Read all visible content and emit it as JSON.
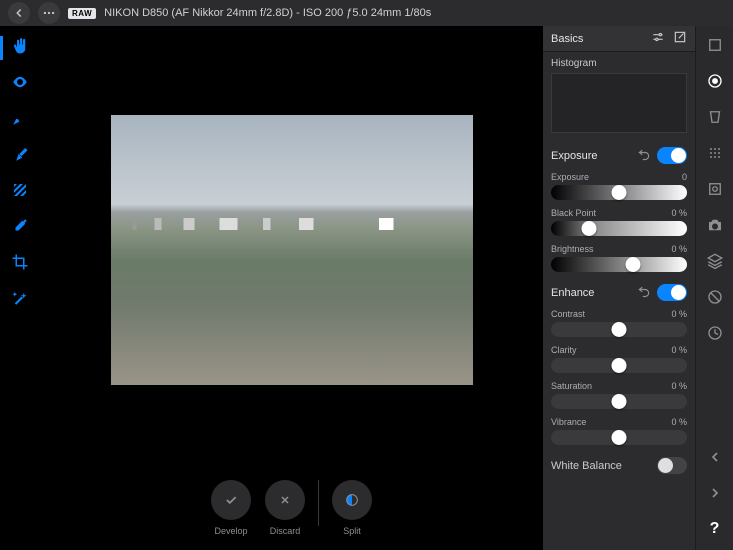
{
  "header": {
    "raw_badge": "RAW",
    "title": "NIKON D850 (AF Nikkor 24mm f/2.8D) - ISO 200 ƒ5.0 24mm 1/80s"
  },
  "bottom": {
    "develop": "Develop",
    "discard": "Discard",
    "split": "Split"
  },
  "panel": {
    "title": "Basics",
    "histogram_label": "Histogram",
    "sections": {
      "exposure": {
        "title": "Exposure",
        "toggle_on": true
      },
      "enhance": {
        "title": "Enhance",
        "toggle_on": true
      },
      "white_balance": {
        "title": "White Balance",
        "toggle_on": false
      }
    },
    "sliders": {
      "exposure": {
        "label": "Exposure",
        "value": "0",
        "pos": 0.5
      },
      "black_point": {
        "label": "Black Point",
        "value": "0 %",
        "pos": 0.28
      },
      "brightness": {
        "label": "Brightness",
        "value": "0 %",
        "pos": 0.6
      },
      "contrast": {
        "label": "Contrast",
        "value": "0 %",
        "pos": 0.5
      },
      "clarity": {
        "label": "Clarity",
        "value": "0 %",
        "pos": 0.5
      },
      "saturation": {
        "label": "Saturation",
        "value": "0 %",
        "pos": 0.5
      },
      "vibrance": {
        "label": "Vibrance",
        "value": "0 %",
        "pos": 0.5
      }
    }
  }
}
